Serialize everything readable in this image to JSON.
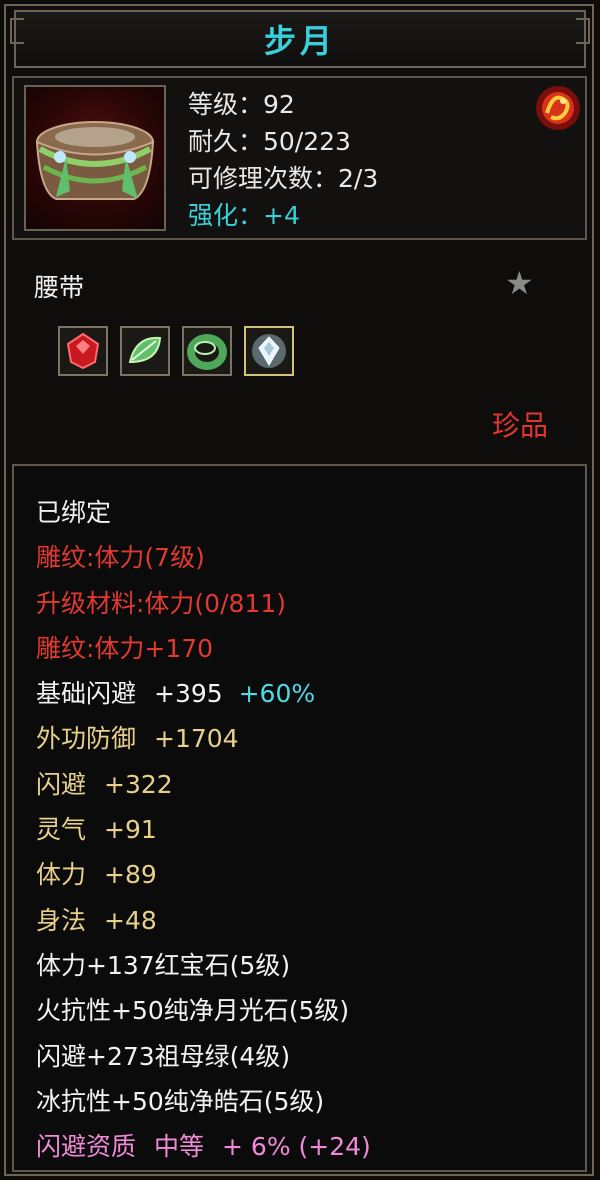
{
  "item": {
    "name": "步月",
    "level_line": "等级：92",
    "durability_line": "耐久：50/223",
    "repair_line": "可修理次数：2/3",
    "enhance_line": "强化：+4",
    "type": "腰带",
    "rarity": "珍品",
    "icon": "belt-icon",
    "badge_icon": "fire-dragon-icon",
    "star_icon": "star-icon"
  },
  "gems": [
    {
      "name": "red-gem-icon"
    },
    {
      "name": "green-leaf-gem-icon"
    },
    {
      "name": "jade-ring-gem-icon"
    },
    {
      "name": "diamond-gem-icon"
    }
  ],
  "attributes": {
    "bound": "已绑定",
    "engrave1": "雕纹:体力(7级)",
    "upgrade_mat": "升级材料:体力(0/811)",
    "engrave2": "雕纹:体力+170",
    "base_dodge_label": "基础闪避",
    "base_dodge_value": "+395",
    "base_dodge_bonus": "+60%",
    "ext_def_label": "外功防御",
    "ext_def_value": "+1704",
    "dodge_label": "闪避",
    "dodge_value": "+322",
    "spirit_label": "灵气",
    "spirit_value": "+91",
    "stamina_label": "体力",
    "stamina_value": "+89",
    "agility_label": "身法",
    "agility_value": "+48",
    "gem1": "体力+137红宝石(5级)",
    "gem2": "火抗性+50纯净月光石(5级)",
    "gem3": "闪避+273祖母绿(4级)",
    "gem4": "冰抗性+50纯净皓石(5级)",
    "quality_label": "闪避资质",
    "quality_grade": "中等",
    "quality_value": "+ 6% (+24)"
  },
  "colors": {
    "title": "#39d0da",
    "rare": "#e2352f",
    "engrave": "#e03a30",
    "base_attr": "#e8d08a",
    "quality": "#f08ad8"
  }
}
